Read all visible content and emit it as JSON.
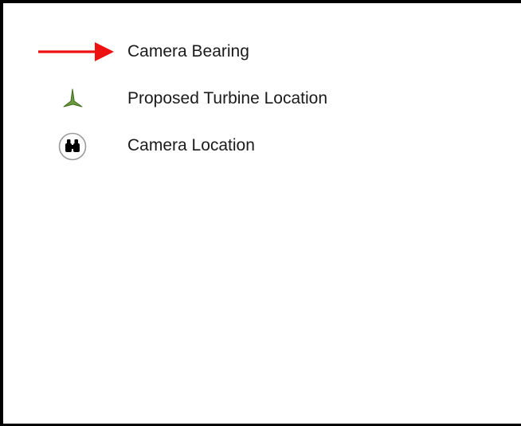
{
  "legend": {
    "items": [
      {
        "label": "Camera Bearing",
        "symbol": "red-arrow-icon",
        "color": "#ee1111"
      },
      {
        "label": "Proposed Turbine Location",
        "symbol": "wind-turbine-icon",
        "color": "#6a9a3c"
      },
      {
        "label": "Camera Location",
        "symbol": "binoculars-icon",
        "color": "#000000"
      }
    ]
  }
}
